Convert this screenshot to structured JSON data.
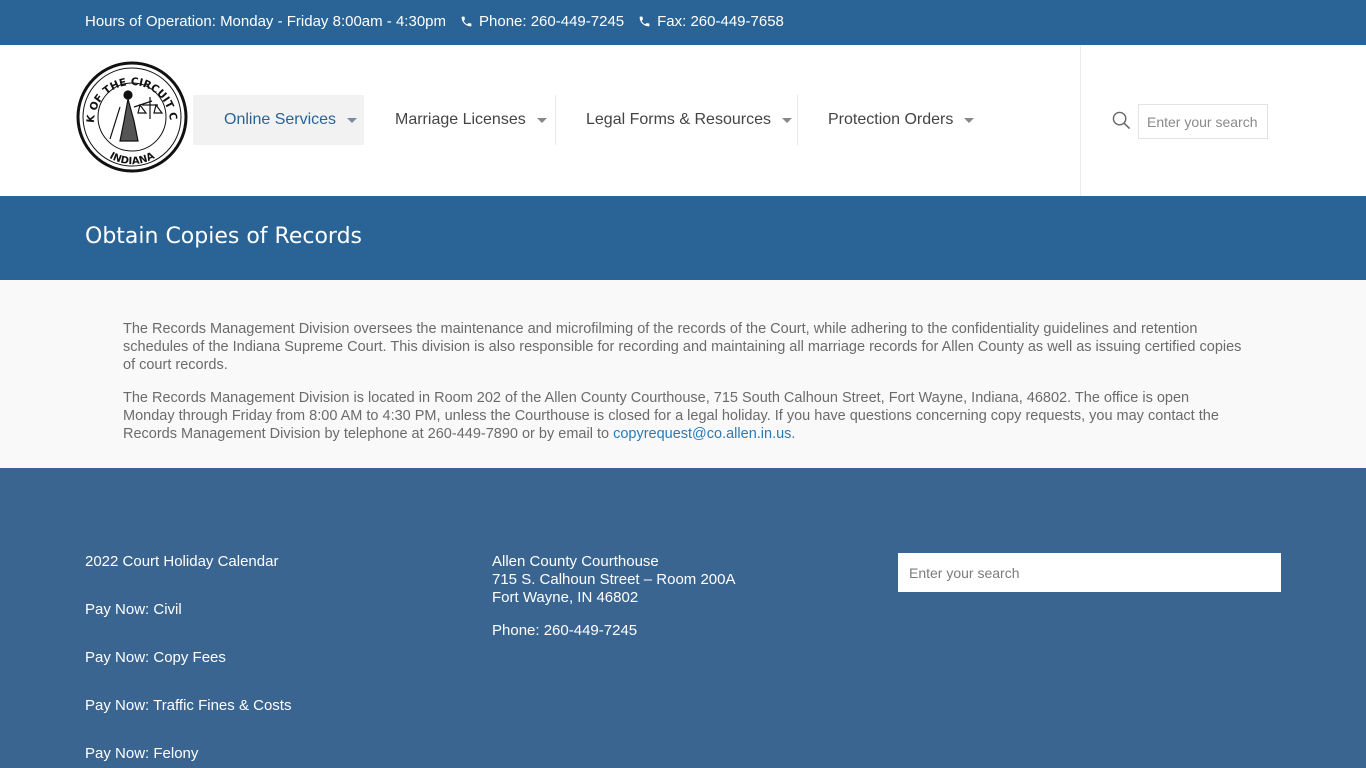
{
  "topbar": {
    "hours": "Hours of Operation: Monday - Friday 8:00am - 4:30pm",
    "phone": "Phone: 260-449-7245",
    "fax": "Fax: 260-449-7658"
  },
  "logo": {
    "seal_text_top": "CLERK OF THE CIRCUIT COURT",
    "seal_text_bottom": "INDIANA"
  },
  "nav": {
    "items": [
      {
        "label": "Online Services",
        "active": true
      },
      {
        "label": "Marriage Licenses"
      },
      {
        "label": "Legal Forms & Resources"
      },
      {
        "label": "Protection Orders"
      }
    ]
  },
  "header_search": {
    "placeholder": "Enter your search"
  },
  "page": {
    "title": "Obtain Copies of Records"
  },
  "content": {
    "paragraph1": "The Records Management Division oversees the maintenance and microfilming of the records of the Court, while adhering to the confidentiality guidelines and retention schedules of the Indiana Supreme Court. This division is also responsible for recording and maintaining all marriage records for Allen County as well as issuing certified copies of court records.",
    "paragraph2_text": "The Records Management Division is located in Room 202 of the Allen County Courthouse, 715 South Calhoun Street, Fort Wayne, Indiana, 46802. The office is open Monday through Friday from 8:00 AM to 4:30 PM, unless the Courthouse is closed for a legal holiday. If you have questions concerning copy requests, you may contact the Records Management Division by telephone at 260-449-7890 or by email to ",
    "email_link": "copyrequest@co.allen.in.us",
    "paragraph2_end": "."
  },
  "footer": {
    "links": [
      "2022 Court Holiday Calendar",
      "Pay Now: Civil",
      "Pay Now: Copy Fees",
      "Pay Now: Traffic Fines & Costs",
      "Pay Now: Felony"
    ],
    "address": {
      "line1": "Allen County Courthouse",
      "line2": "715 S. Calhoun Street – Room 200A",
      "line3": "Fort Wayne, IN 46802",
      "phone": "Phone: 260-449-7245"
    },
    "search_placeholder": "Enter your search"
  },
  "colors": {
    "primary_blue": "#2a6496",
    "footer_blue": "#3a6591",
    "link_blue": "#2a7ab8"
  }
}
